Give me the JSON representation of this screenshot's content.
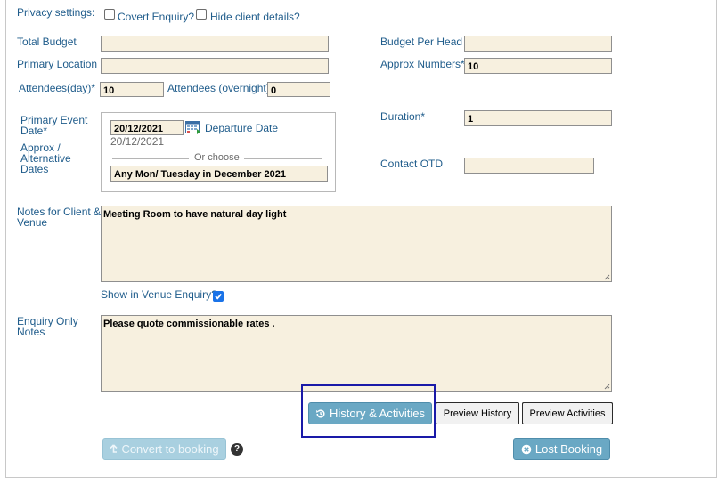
{
  "privacy": {
    "label": "Privacy settings:",
    "covert_label": "Covert Enquiry?",
    "covert_checked": false,
    "hide_label": "Hide client details?",
    "hide_checked": false
  },
  "fields": {
    "total_budget_label": "Total Budget",
    "total_budget_value": "",
    "primary_location_label": "Primary Location",
    "primary_location_value": "",
    "attendees_day_label": "Attendees(day)*",
    "attendees_day_value": "10",
    "attendees_overnight_label": "Attendees (overnight)",
    "attendees_overnight_value": "0",
    "budget_per_head_label": "Budget Per Head",
    "budget_per_head_value": "",
    "approx_numbers_label": "Approx Numbers*",
    "approx_numbers_value": "10"
  },
  "event": {
    "primary_date_label_1": "Primary Event",
    "primary_date_label_2": "Date*",
    "date_value": "20/12/2021",
    "date_display": "20/12/2021",
    "departure_link": "Departure Date",
    "alt_label_1": "Approx /",
    "alt_label_2": "Alternative",
    "alt_label_3": "Dates",
    "or_choose": "Or choose",
    "alt_value": "Any Mon/ Tuesday in December 2021",
    "duration_label": "Duration*",
    "duration_value": "1",
    "contact_otd_label": "Contact OTD",
    "contact_otd_value": ""
  },
  "notes": {
    "client_venue_label_1": "Notes for Client &",
    "client_venue_label_2": "Venue",
    "client_venue_value": "Meeting Room to have natural day light",
    "show_in_venue_label": "Show in Venue Enquiry?",
    "show_in_venue_checked": true,
    "enquiry_only_label_1": "Enquiry Only",
    "enquiry_only_label_2": "Notes",
    "enquiry_only_value": "Please quote commissionable rates ."
  },
  "buttons": {
    "history_activities": "History & Activities",
    "preview_history": "Preview History",
    "preview_activities": "Preview Activities",
    "convert_to_booking": "Convert to booking",
    "help": "?",
    "lost_booking": "Lost Booking"
  },
  "colors": {
    "label": "#1f5c8b",
    "field_bg": "#f7f0df",
    "teal_button": "#6aa8c4",
    "highlight_box": "#1a1aa8"
  },
  "icons": {
    "calendar": "calendar-icon",
    "history": "history-icon",
    "convert": "arrow-up-icon",
    "help": "help-icon",
    "lost": "cancel-circle-icon"
  }
}
